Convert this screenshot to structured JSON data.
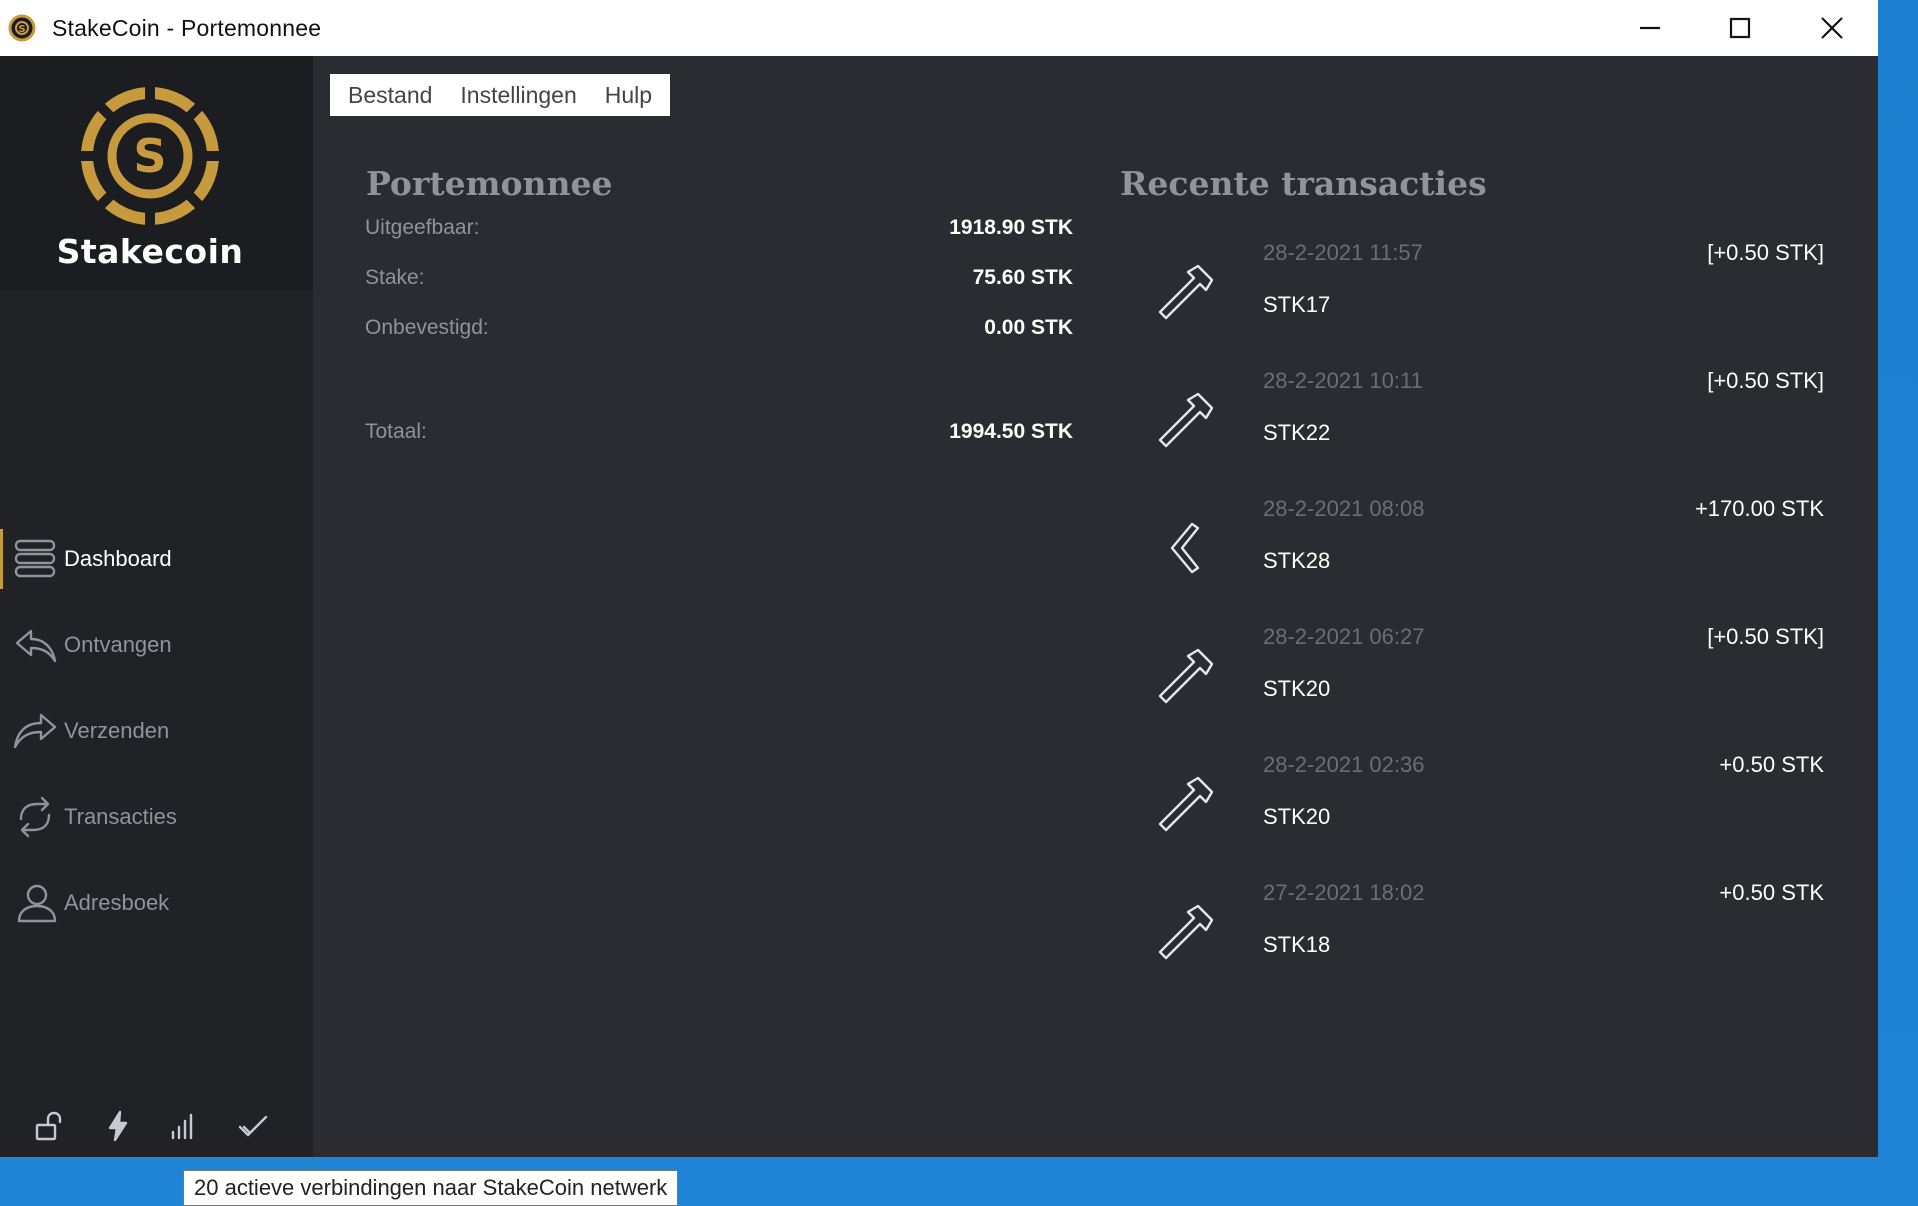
{
  "window": {
    "title": "StakeCoin - Portemonnee"
  },
  "brand": {
    "name": "Stakecoin",
    "accent_color": "#c79a3e"
  },
  "menu": {
    "items": [
      "Bestand",
      "Instellingen",
      "Hulp"
    ]
  },
  "sidebar": {
    "items": [
      {
        "label": "Dashboard",
        "icon": "dashboard-icon",
        "active": true
      },
      {
        "label": "Ontvangen",
        "icon": "receive-icon",
        "active": false
      },
      {
        "label": "Verzenden",
        "icon": "send-icon",
        "active": false
      },
      {
        "label": "Transacties",
        "icon": "transactions-icon",
        "active": false
      },
      {
        "label": "Adresboek",
        "icon": "address-book-icon",
        "active": false
      }
    ],
    "status_icons": [
      "lock-open-icon",
      "staking-bolt-icon",
      "connections-signal-icon",
      "synced-check-icon"
    ]
  },
  "wallet": {
    "title": "Portemonnee",
    "spendable_label": "Uitgeefbaar:",
    "spendable_value": "1918.90 STK",
    "stake_label": "Stake:",
    "stake_value": "75.60 STK",
    "unconfirmed_label": "Onbevestigd:",
    "unconfirmed_value": "0.00 STK",
    "total_label": "Totaal:",
    "total_value": "1994.50 STK"
  },
  "recent": {
    "title": "Recente transacties",
    "items": [
      {
        "type": "mined-hammer-icon",
        "date": "28-2-2021 11:57",
        "address": "STK17",
        "amount": "[+0.50 STK]"
      },
      {
        "type": "mined-hammer-icon",
        "date": "28-2-2021 10:11",
        "address": "STK22",
        "amount": "[+0.50 STK]"
      },
      {
        "type": "received-chevron-icon",
        "date": "28-2-2021 08:08",
        "address": "STK28",
        "amount": "+170.00 STK"
      },
      {
        "type": "mined-hammer-icon",
        "date": "28-2-2021 06:27",
        "address": "STK20",
        "amount": "[+0.50 STK]"
      },
      {
        "type": "mined-hammer-icon",
        "date": "28-2-2021 02:36",
        "address": "STK20",
        "amount": "+0.50 STK"
      },
      {
        "type": "mined-hammer-icon",
        "date": "27-2-2021 18:02",
        "address": "STK18",
        "amount": "+0.50 STK"
      }
    ]
  },
  "tooltip": {
    "text": "20 actieve verbindingen naar StakeCoin netwerk"
  }
}
